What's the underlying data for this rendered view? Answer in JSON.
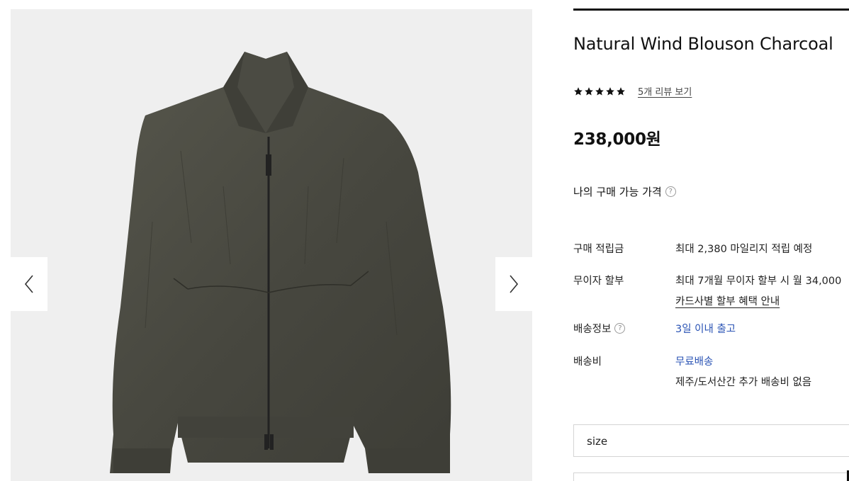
{
  "product": {
    "title": "Natural Wind Blouson Charcoal",
    "rating_stars": 5,
    "review_link": "5개 리뷰 보기",
    "price": "238,000원"
  },
  "my_price": {
    "label": "나의 구매 가능 가격",
    "help_icon": "?"
  },
  "details": {
    "points_label": "구매 적립금",
    "points_value": "최대 2,380 마일리지 적립 예정",
    "installment_label": "무이자 할부",
    "installment_value": "최대 7개월 무이자 할부 시 월 34,000",
    "installment_link": "카드사별 할부 혜택 안내",
    "shipping_info_label": "배송정보",
    "shipping_info_value": "3일 이내 출고",
    "shipping_fee_label": "배송비",
    "shipping_fee_value": "무료배송",
    "shipping_fee_note": "제주/도서산간 추가 배송비 없음"
  },
  "options": {
    "size_placeholder": "size"
  },
  "icons": {
    "prev": "chevron-left-icon",
    "next": "chevron-right-icon",
    "star": "star-icon",
    "help": "question-circle-icon"
  },
  "colors": {
    "link_blue": "#2a53b4",
    "gallery_bg": "#efefef",
    "jacket": "#4a4a42"
  }
}
